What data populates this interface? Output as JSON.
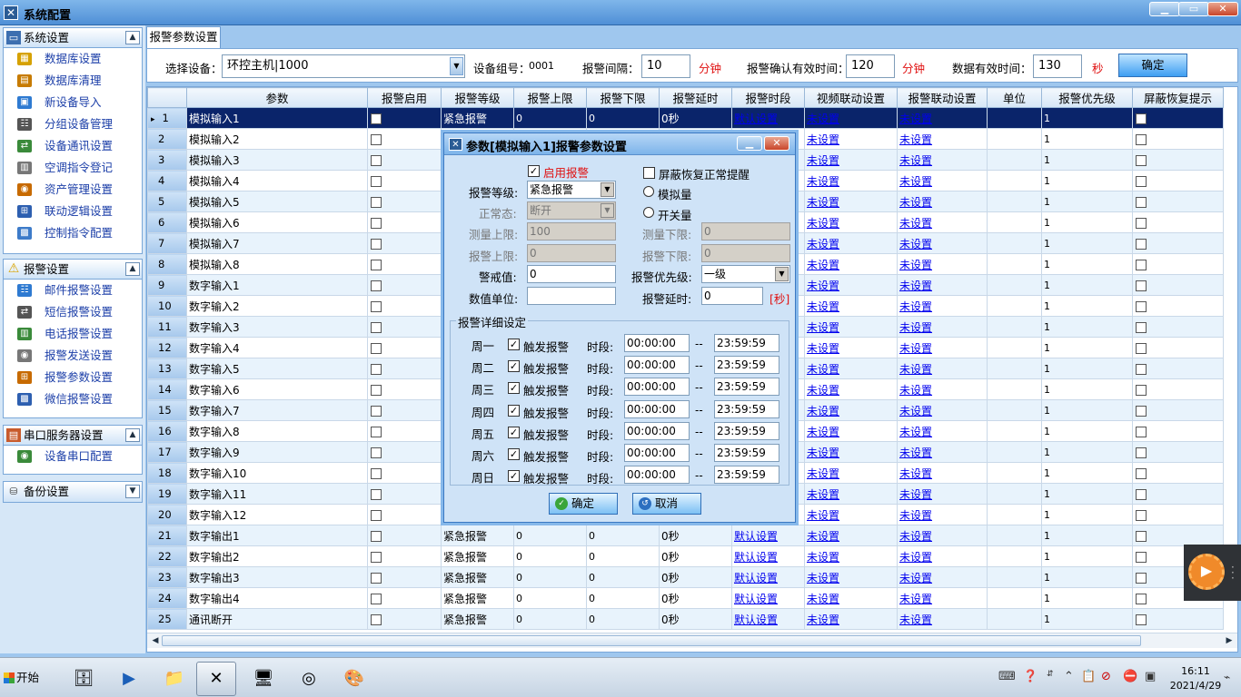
{
  "window": {
    "title": "系统配置",
    "controls": [
      "▁",
      "▭",
      "✕"
    ]
  },
  "sidebar": {
    "groups": [
      {
        "title": "系统设置",
        "items": [
          "数据库设置",
          "数据库清理",
          "新设备导入",
          "分组设备管理",
          "设备通讯设置",
          "空调指令登记",
          "资产管理设置",
          "联动逻辑设置",
          "控制指令配置"
        ]
      },
      {
        "title": "报警设置",
        "items": [
          "邮件报警设置",
          "短信报警设置",
          "电话报警设置",
          "报警发送设置",
          "报警参数设置",
          "微信报警设置"
        ]
      },
      {
        "title": "串口服务器设置",
        "items": [
          "设备串口配置"
        ]
      },
      {
        "title": "备份设置",
        "items": []
      }
    ]
  },
  "tab": {
    "label": "报警参数设置"
  },
  "toolbar": {
    "device_label": "选择设备：",
    "device_value": "环控主机|1000",
    "group_label": "设备组号：",
    "group_value": "0001",
    "interval_label": "报警间隔：",
    "interval_value": "10",
    "interval_unit": "分钟",
    "confirm_label": "报警确认有效时间：",
    "confirm_value": "120",
    "confirm_unit": "分钟",
    "data_label": "数据有效时间：",
    "data_value": "130",
    "data_unit": "秒",
    "ok": "确定"
  },
  "grid": {
    "columns": [
      "",
      "参数",
      "报警启用",
      "报警等级",
      "报警上限",
      "报警下限",
      "报警延时",
      "报警时段",
      "视频联动设置",
      "报警联动设置",
      "单位",
      "报警优先级",
      "屏蔽恢复提示"
    ],
    "rows": [
      [
        "1",
        "模拟输入1",
        "紧急报警",
        "0",
        "0",
        "0秒",
        "默认设置",
        "未设置",
        "未设置",
        "",
        "1"
      ],
      [
        "2",
        "模拟输入2",
        "",
        "",
        "",
        "",
        "",
        "未设置",
        "未设置",
        "",
        "1"
      ],
      [
        "3",
        "模拟输入3",
        "",
        "",
        "",
        "",
        "",
        "未设置",
        "未设置",
        "",
        "1"
      ],
      [
        "4",
        "模拟输入4",
        "",
        "",
        "",
        "",
        "",
        "未设置",
        "未设置",
        "",
        "1"
      ],
      [
        "5",
        "模拟输入5",
        "",
        "",
        "",
        "",
        "",
        "未设置",
        "未设置",
        "",
        "1"
      ],
      [
        "6",
        "模拟输入6",
        "",
        "",
        "",
        "",
        "",
        "未设置",
        "未设置",
        "",
        "1"
      ],
      [
        "7",
        "模拟输入7",
        "",
        "",
        "",
        "",
        "",
        "未设置",
        "未设置",
        "",
        "1"
      ],
      [
        "8",
        "模拟输入8",
        "",
        "",
        "",
        "",
        "",
        "未设置",
        "未设置",
        "",
        "1"
      ],
      [
        "9",
        "数字输入1",
        "",
        "",
        "",
        "",
        "",
        "未设置",
        "未设置",
        "",
        "1"
      ],
      [
        "10",
        "数字输入2",
        "",
        "",
        "",
        "",
        "",
        "未设置",
        "未设置",
        "",
        "1"
      ],
      [
        "11",
        "数字输入3",
        "",
        "",
        "",
        "",
        "",
        "未设置",
        "未设置",
        "",
        "1"
      ],
      [
        "12",
        "数字输入4",
        "",
        "",
        "",
        "",
        "",
        "未设置",
        "未设置",
        "",
        "1"
      ],
      [
        "13",
        "数字输入5",
        "",
        "",
        "",
        "",
        "",
        "未设置",
        "未设置",
        "",
        "1"
      ],
      [
        "14",
        "数字输入6",
        "",
        "",
        "",
        "",
        "",
        "未设置",
        "未设置",
        "",
        "1"
      ],
      [
        "15",
        "数字输入7",
        "",
        "",
        "",
        "",
        "",
        "未设置",
        "未设置",
        "",
        "1"
      ],
      [
        "16",
        "数字输入8",
        "",
        "",
        "",
        "",
        "",
        "未设置",
        "未设置",
        "",
        "1"
      ],
      [
        "17",
        "数字输入9",
        "",
        "",
        "",
        "",
        "",
        "未设置",
        "未设置",
        "",
        "1"
      ],
      [
        "18",
        "数字输入10",
        "",
        "",
        "",
        "",
        "",
        "未设置",
        "未设置",
        "",
        "1"
      ],
      [
        "19",
        "数字输入11",
        "",
        "",
        "",
        "",
        "",
        "未设置",
        "未设置",
        "",
        "1"
      ],
      [
        "20",
        "数字输入12",
        "",
        "",
        "",
        "",
        "",
        "未设置",
        "未设置",
        "",
        "1"
      ],
      [
        "21",
        "数字输出1",
        "紧急报警",
        "0",
        "0",
        "0秒",
        "默认设置",
        "未设置",
        "未设置",
        "",
        "1"
      ],
      [
        "22",
        "数字输出2",
        "紧急报警",
        "0",
        "0",
        "0秒",
        "默认设置",
        "未设置",
        "未设置",
        "",
        "1"
      ],
      [
        "23",
        "数字输出3",
        "紧急报警",
        "0",
        "0",
        "0秒",
        "默认设置",
        "未设置",
        "未设置",
        "",
        "1"
      ],
      [
        "24",
        "数字输出4",
        "紧急报警",
        "0",
        "0",
        "0秒",
        "默认设置",
        "未设置",
        "未设置",
        "",
        "1"
      ],
      [
        "25",
        "通讯断开",
        "紧急报警",
        "0",
        "0",
        "0秒",
        "默认设置",
        "未设置",
        "未设置",
        "",
        "1"
      ]
    ]
  },
  "dialog": {
    "title": "参数[模拟输入1]报警参数设置",
    "enable_label": "启用报警",
    "mask_label": "屏蔽恢复正常提醒",
    "level_label": "报警等级:",
    "level_value": "紧急报警",
    "analog_label": "模拟量",
    "normal_label": "正常态:",
    "normal_value": "断开",
    "switch_label": "开关量",
    "meas_upper_label": "测量上限:",
    "meas_upper_value": "100",
    "meas_lower_label": "测量下限:",
    "meas_lower_value": "0",
    "alarm_upper_label": "报警上限:",
    "alarm_upper_value": "0",
    "alarm_lower_label": "报警下限:",
    "alarm_lower_value": "0",
    "warn_label": "警戒值:",
    "warn_value": "0",
    "priority_label": "报警优先级:",
    "priority_value": "一级",
    "unit_label": "数值单位:",
    "unit_value": "",
    "delay_label": "报警延时:",
    "delay_value": "0",
    "delay_unit": "[秒]",
    "detail_legend": "报警详细设定",
    "trigger_label": "触发报警",
    "period_label": "时段:",
    "dash": "--",
    "days": [
      {
        "day": "周一",
        "start": "00:00:00",
        "end": "23:59:59"
      },
      {
        "day": "周二",
        "start": "00:00:00",
        "end": "23:59:59"
      },
      {
        "day": "周三",
        "start": "00:00:00",
        "end": "23:59:59"
      },
      {
        "day": "周四",
        "start": "00:00:00",
        "end": "23:59:59"
      },
      {
        "day": "周五",
        "start": "00:00:00",
        "end": "23:59:59"
      },
      {
        "day": "周六",
        "start": "00:00:00",
        "end": "23:59:59"
      },
      {
        "day": "周日",
        "start": "00:00:00",
        "end": "23:59:59"
      }
    ],
    "ok": "确定",
    "cancel": "取消"
  },
  "taskbar": {
    "start": "开始",
    "time": "16:11",
    "date": "2021/4/29"
  }
}
